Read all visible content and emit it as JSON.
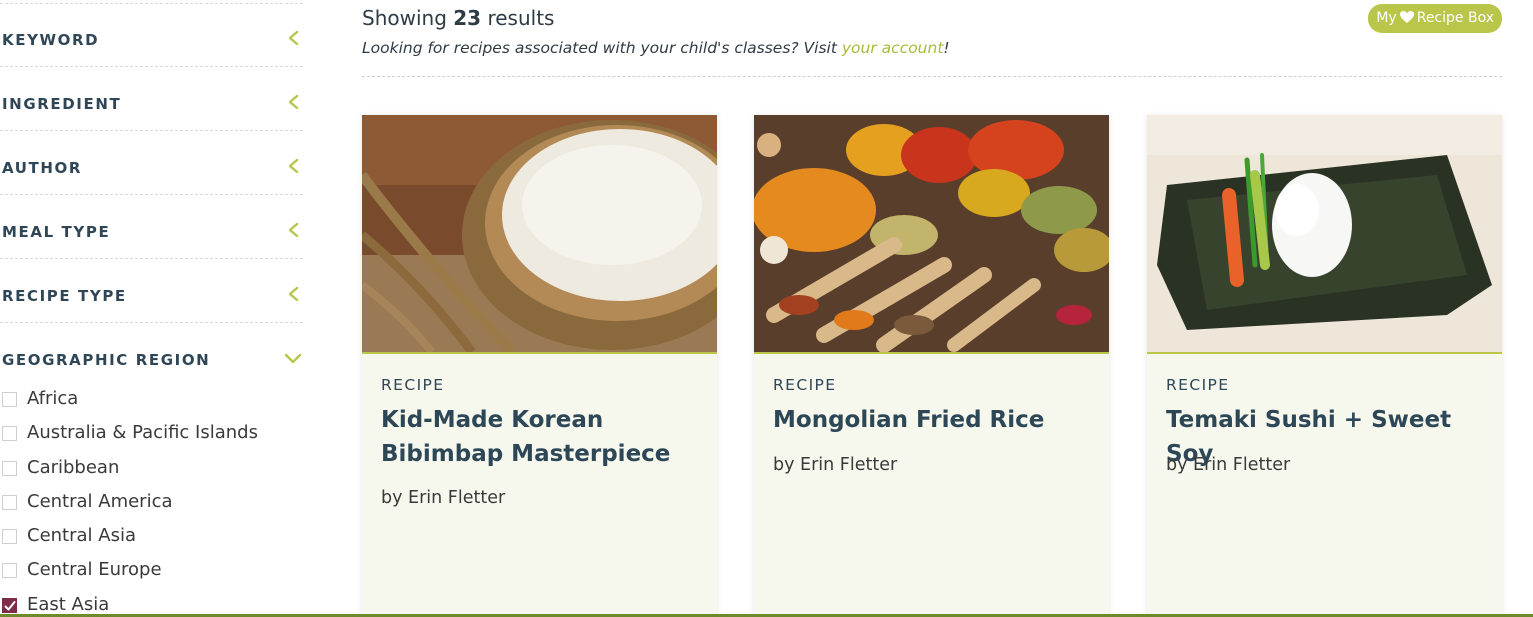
{
  "sidebar": {
    "facets": [
      {
        "label": "KEYWORD",
        "state": "collapsed"
      },
      {
        "label": "INGREDIENT",
        "state": "collapsed"
      },
      {
        "label": "AUTHOR",
        "state": "collapsed"
      },
      {
        "label": "MEAL TYPE",
        "state": "collapsed"
      },
      {
        "label": "RECIPE TYPE",
        "state": "collapsed"
      },
      {
        "label": "GEOGRAPHIC REGION",
        "state": "expanded"
      }
    ],
    "regions": [
      {
        "label": "Africa",
        "checked": false
      },
      {
        "label": "Australia & Pacific Islands",
        "checked": false
      },
      {
        "label": "Caribbean",
        "checked": false
      },
      {
        "label": "Central America",
        "checked": false
      },
      {
        "label": "Central Asia",
        "checked": false
      },
      {
        "label": "Central Europe",
        "checked": false
      },
      {
        "label": "East Asia",
        "checked": true
      }
    ]
  },
  "header": {
    "showing_prefix": "Showing",
    "result_count": "23",
    "showing_suffix": "results",
    "note_prefix": "Looking for recipes associated with your child's classes? Visit",
    "note_link": "your account",
    "note_suffix": "!",
    "recipe_box_my": "My",
    "recipe_box_label": "Recipe Box"
  },
  "cards": [
    {
      "type": "RECIPE",
      "title": "Kid-Made Korean Bibimbap Masterpiece",
      "author": "by Erin Fletter",
      "image_icon": "rice-bowl-photo"
    },
    {
      "type": "RECIPE",
      "title": "Mongolian Fried Rice",
      "author": "by Erin Fletter",
      "image_icon": "spices-photo"
    },
    {
      "type": "RECIPE",
      "title": "Temaki Sushi + Sweet Soy",
      "author": "by Erin Fletter",
      "image_icon": "sushi-seaweed-photo"
    }
  ],
  "colors": {
    "accent": "#b9c64a",
    "link": "#a8bb3a",
    "heading": "#2e4757",
    "card_bg": "#f6f8ee",
    "checked": "#7b2d4a"
  }
}
